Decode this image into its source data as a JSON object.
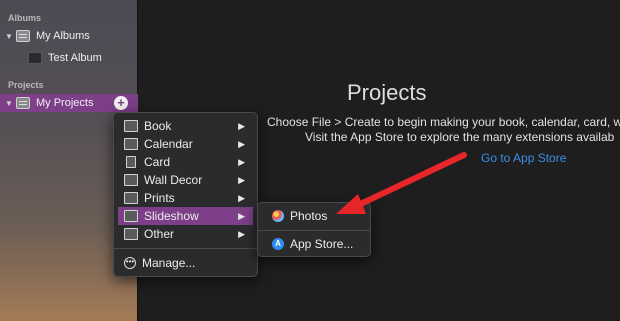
{
  "sidebar": {
    "sections": [
      {
        "header": "Albums",
        "items": [
          {
            "label": "My Albums",
            "type": "folder"
          },
          {
            "label": "Test Album",
            "type": "album"
          }
        ]
      },
      {
        "header": "Projects",
        "items": [
          {
            "label": "My Projects",
            "type": "folder",
            "selected": true
          }
        ]
      }
    ]
  },
  "main": {
    "title": "Projects",
    "line1": "Choose File > Create to begin making your book, calendar, card, w",
    "line2": "Visit the App Store to explore the many extensions availab",
    "link": "Go to App Store"
  },
  "context_menu": {
    "items": [
      {
        "label": "Book",
        "icon": "book-icon",
        "submenu": true
      },
      {
        "label": "Calendar",
        "icon": "calendar-icon",
        "submenu": true
      },
      {
        "label": "Card",
        "icon": "card-icon",
        "submenu": true
      },
      {
        "label": "Wall Decor",
        "icon": "wall-decor-icon",
        "submenu": true
      },
      {
        "label": "Prints",
        "icon": "prints-icon",
        "submenu": true
      },
      {
        "label": "Slideshow",
        "icon": "slideshow-icon",
        "submenu": true,
        "highlighted": true
      },
      {
        "label": "Other",
        "icon": "other-icon",
        "submenu": true
      }
    ],
    "manage_label": "Manage..."
  },
  "submenu": {
    "items": [
      {
        "label": "Photos",
        "icon": "photos-app-icon"
      },
      {
        "label": "App Store...",
        "icon": "app-store-icon"
      }
    ]
  },
  "colors": {
    "highlight": "#7c3f88",
    "link": "#3d8ee8",
    "annotation_arrow": "#e8262a"
  }
}
